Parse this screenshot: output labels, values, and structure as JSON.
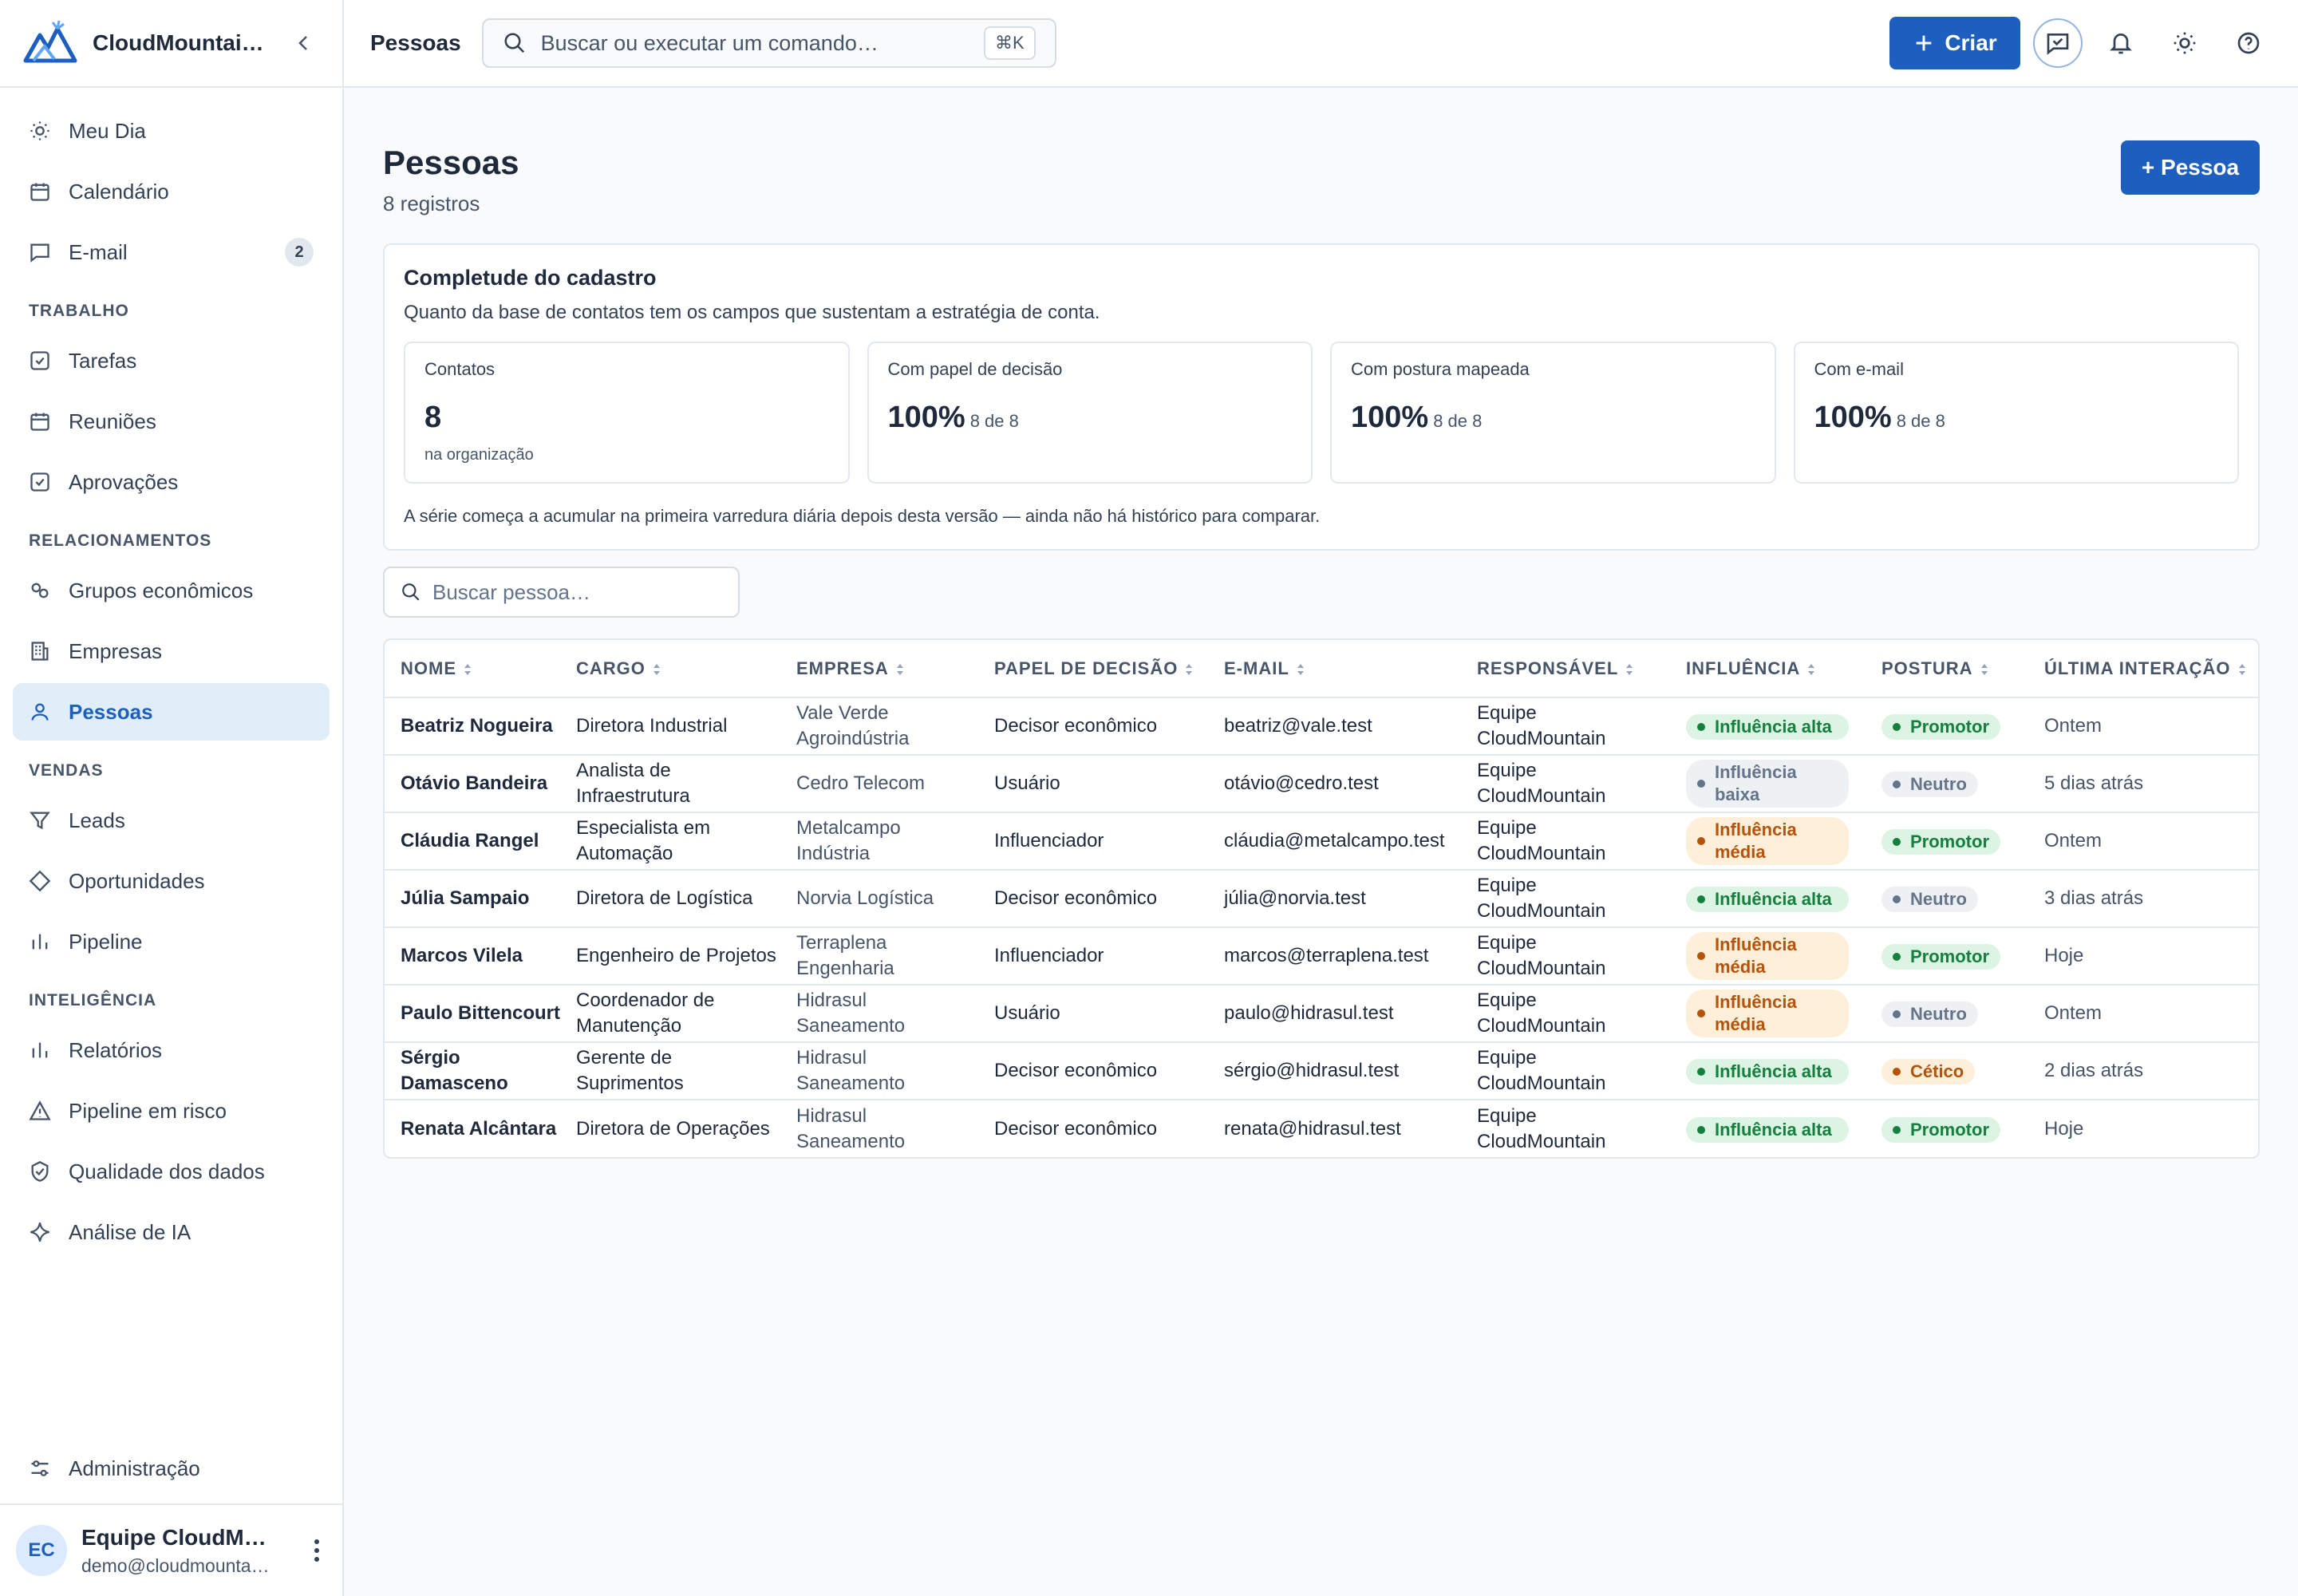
{
  "brand": {
    "name": "CloudMountai…"
  },
  "sidebar": {
    "top_items": [
      {
        "label": "Meu Dia"
      },
      {
        "label": "Calendário"
      },
      {
        "label": "E-mail",
        "badge": "2"
      }
    ],
    "sections": [
      {
        "title": "TRABALHO",
        "items": [
          {
            "label": "Tarefas"
          },
          {
            "label": "Reuniões"
          },
          {
            "label": "Aprovações"
          }
        ]
      },
      {
        "title": "RELACIONAMENTOS",
        "items": [
          {
            "label": "Grupos econômicos"
          },
          {
            "label": "Empresas"
          },
          {
            "label": "Pessoas"
          }
        ]
      },
      {
        "title": "VENDAS",
        "items": [
          {
            "label": "Leads"
          },
          {
            "label": "Oportunidades"
          },
          {
            "label": "Pipeline"
          }
        ]
      },
      {
        "title": "INTELIGÊNCIA",
        "items": [
          {
            "label": "Relatórios"
          },
          {
            "label": "Pipeline em risco"
          },
          {
            "label": "Qualidade dos dados"
          },
          {
            "label": "Análise de IA"
          }
        ]
      }
    ],
    "admin_label": "Administração",
    "user": {
      "initials": "EC",
      "name": "Equipe CloudMo…",
      "email": "demo@cloudmounta…"
    }
  },
  "topbar": {
    "title": "Pessoas",
    "command_placeholder": "Buscar ou executar um comando…",
    "shortcut": "⌘K",
    "create_label": "Criar"
  },
  "page": {
    "title": "Pessoas",
    "subtitle": "8 registros",
    "add_button": "+ Pessoa"
  },
  "completeness": {
    "title": "Completude do cadastro",
    "description": "Quanto da base de contatos tem os campos que sustentam a estratégia de conta.",
    "stats": [
      {
        "label": "Contatos",
        "value": "8",
        "detail": "",
        "foot": "na organização"
      },
      {
        "label": "Com papel de decisão",
        "value": "100%",
        "detail": "8 de 8",
        "foot": ""
      },
      {
        "label": "Com postura mapeada",
        "value": "100%",
        "detail": "8 de 8",
        "foot": ""
      },
      {
        "label": "Com e-mail",
        "value": "100%",
        "detail": "8 de 8",
        "foot": ""
      }
    ],
    "note": "A série começa a acumular na primeira varredura diária depois desta versão — ainda não há histórico para comparar."
  },
  "search": {
    "placeholder": "Buscar pessoa…"
  },
  "table": {
    "columns": [
      "NOME",
      "CARGO",
      "EMPRESA",
      "PAPEL DE DECISÃO",
      "E-MAIL",
      "RESPONSÁVEL",
      "INFLUÊNCIA",
      "POSTURA",
      "ÚLTIMA INTERAÇÃO"
    ],
    "rows": [
      {
        "name": "Beatriz Nogueira",
        "role": "Diretora Industrial",
        "company": "Vale Verde Agroindústria",
        "decision": "Decisor econômico",
        "email": "beatriz@vale.test",
        "owner": "Equipe CloudMountain",
        "influence": "Influência alta",
        "influence_level": "alta",
        "posture": "Promotor",
        "last": "Ontem"
      },
      {
        "name": "Otávio Bandeira",
        "role": "Analista de Infraestrutura",
        "company": "Cedro Telecom",
        "decision": "Usuário",
        "email": "otávio@cedro.test",
        "owner": "Equipe CloudMountain",
        "influence": "Influência baixa",
        "influence_level": "baixa",
        "posture": "Neutro",
        "last": "5 dias atrás"
      },
      {
        "name": "Cláudia Rangel",
        "role": "Especialista em Automação",
        "company": "Metalcampo Indústria",
        "decision": "Influenciador",
        "email": "cláudia@metalcampo.test",
        "owner": "Equipe CloudMountain",
        "influence": "Influência média",
        "influence_level": "media",
        "posture": "Promotor",
        "last": "Ontem"
      },
      {
        "name": "Júlia Sampaio",
        "role": "Diretora de Logística",
        "company": "Norvia Logística",
        "decision": "Decisor econômico",
        "email": "júlia@norvia.test",
        "owner": "Equipe CloudMountain",
        "influence": "Influência alta",
        "influence_level": "alta",
        "posture": "Neutro",
        "last": "3 dias atrás"
      },
      {
        "name": "Marcos Vilela",
        "role": "Engenheiro de Projetos",
        "company": "Terraplena Engenharia",
        "decision": "Influenciador",
        "email": "marcos@terraplena.test",
        "owner": "Equipe CloudMountain",
        "influence": "Influência média",
        "influence_level": "media",
        "posture": "Promotor",
        "last": "Hoje"
      },
      {
        "name": "Paulo Bittencourt",
        "role": "Coordenador de Manutenção",
        "company": "Hidrasul Saneamento",
        "decision": "Usuário",
        "email": "paulo@hidrasul.test",
        "owner": "Equipe CloudMountain",
        "influence": "Influência média",
        "influence_level": "media",
        "posture": "Neutro",
        "last": "Ontem"
      },
      {
        "name": "Sérgio Damasceno",
        "role": "Gerente de Suprimentos",
        "company": "Hidrasul Saneamento",
        "decision": "Decisor econômico",
        "email": "sérgio@hidrasul.test",
        "owner": "Equipe CloudMountain",
        "influence": "Influência alta",
        "influence_level": "alta",
        "posture": "Cético",
        "last": "2 dias atrás"
      },
      {
        "name": "Renata Alcântara",
        "role": "Diretora de Operações",
        "company": "Hidrasul Saneamento",
        "decision": "Decisor econômico",
        "email": "renata@hidrasul.test",
        "owner": "Equipe CloudMountain",
        "influence": "Influência alta",
        "influence_level": "alta",
        "posture": "Promotor",
        "last": "Hoje"
      }
    ]
  },
  "colors": {
    "accent": "#1d5fbf",
    "active_bg": "#e0eef9",
    "positive": "#15803d",
    "warning": "#b45309",
    "neutral": "#64748b"
  },
  "icons": {
    "sidebar": [
      "sun-icon",
      "calendar-icon",
      "chat-icon",
      "check-square-icon",
      "calendar-icon",
      "check-square-icon",
      "link-icon",
      "building-icon",
      "user-icon",
      "filter-icon",
      "diamond-icon",
      "bar-chart-icon",
      "bar-chart-icon",
      "warning-icon",
      "shield-check-icon",
      "sparkle-icon",
      "sliders-icon"
    ],
    "topbar": [
      "search-icon",
      "plus-icon",
      "chat-assistant-icon",
      "bell-icon",
      "sun-icon",
      "help-icon"
    ]
  }
}
